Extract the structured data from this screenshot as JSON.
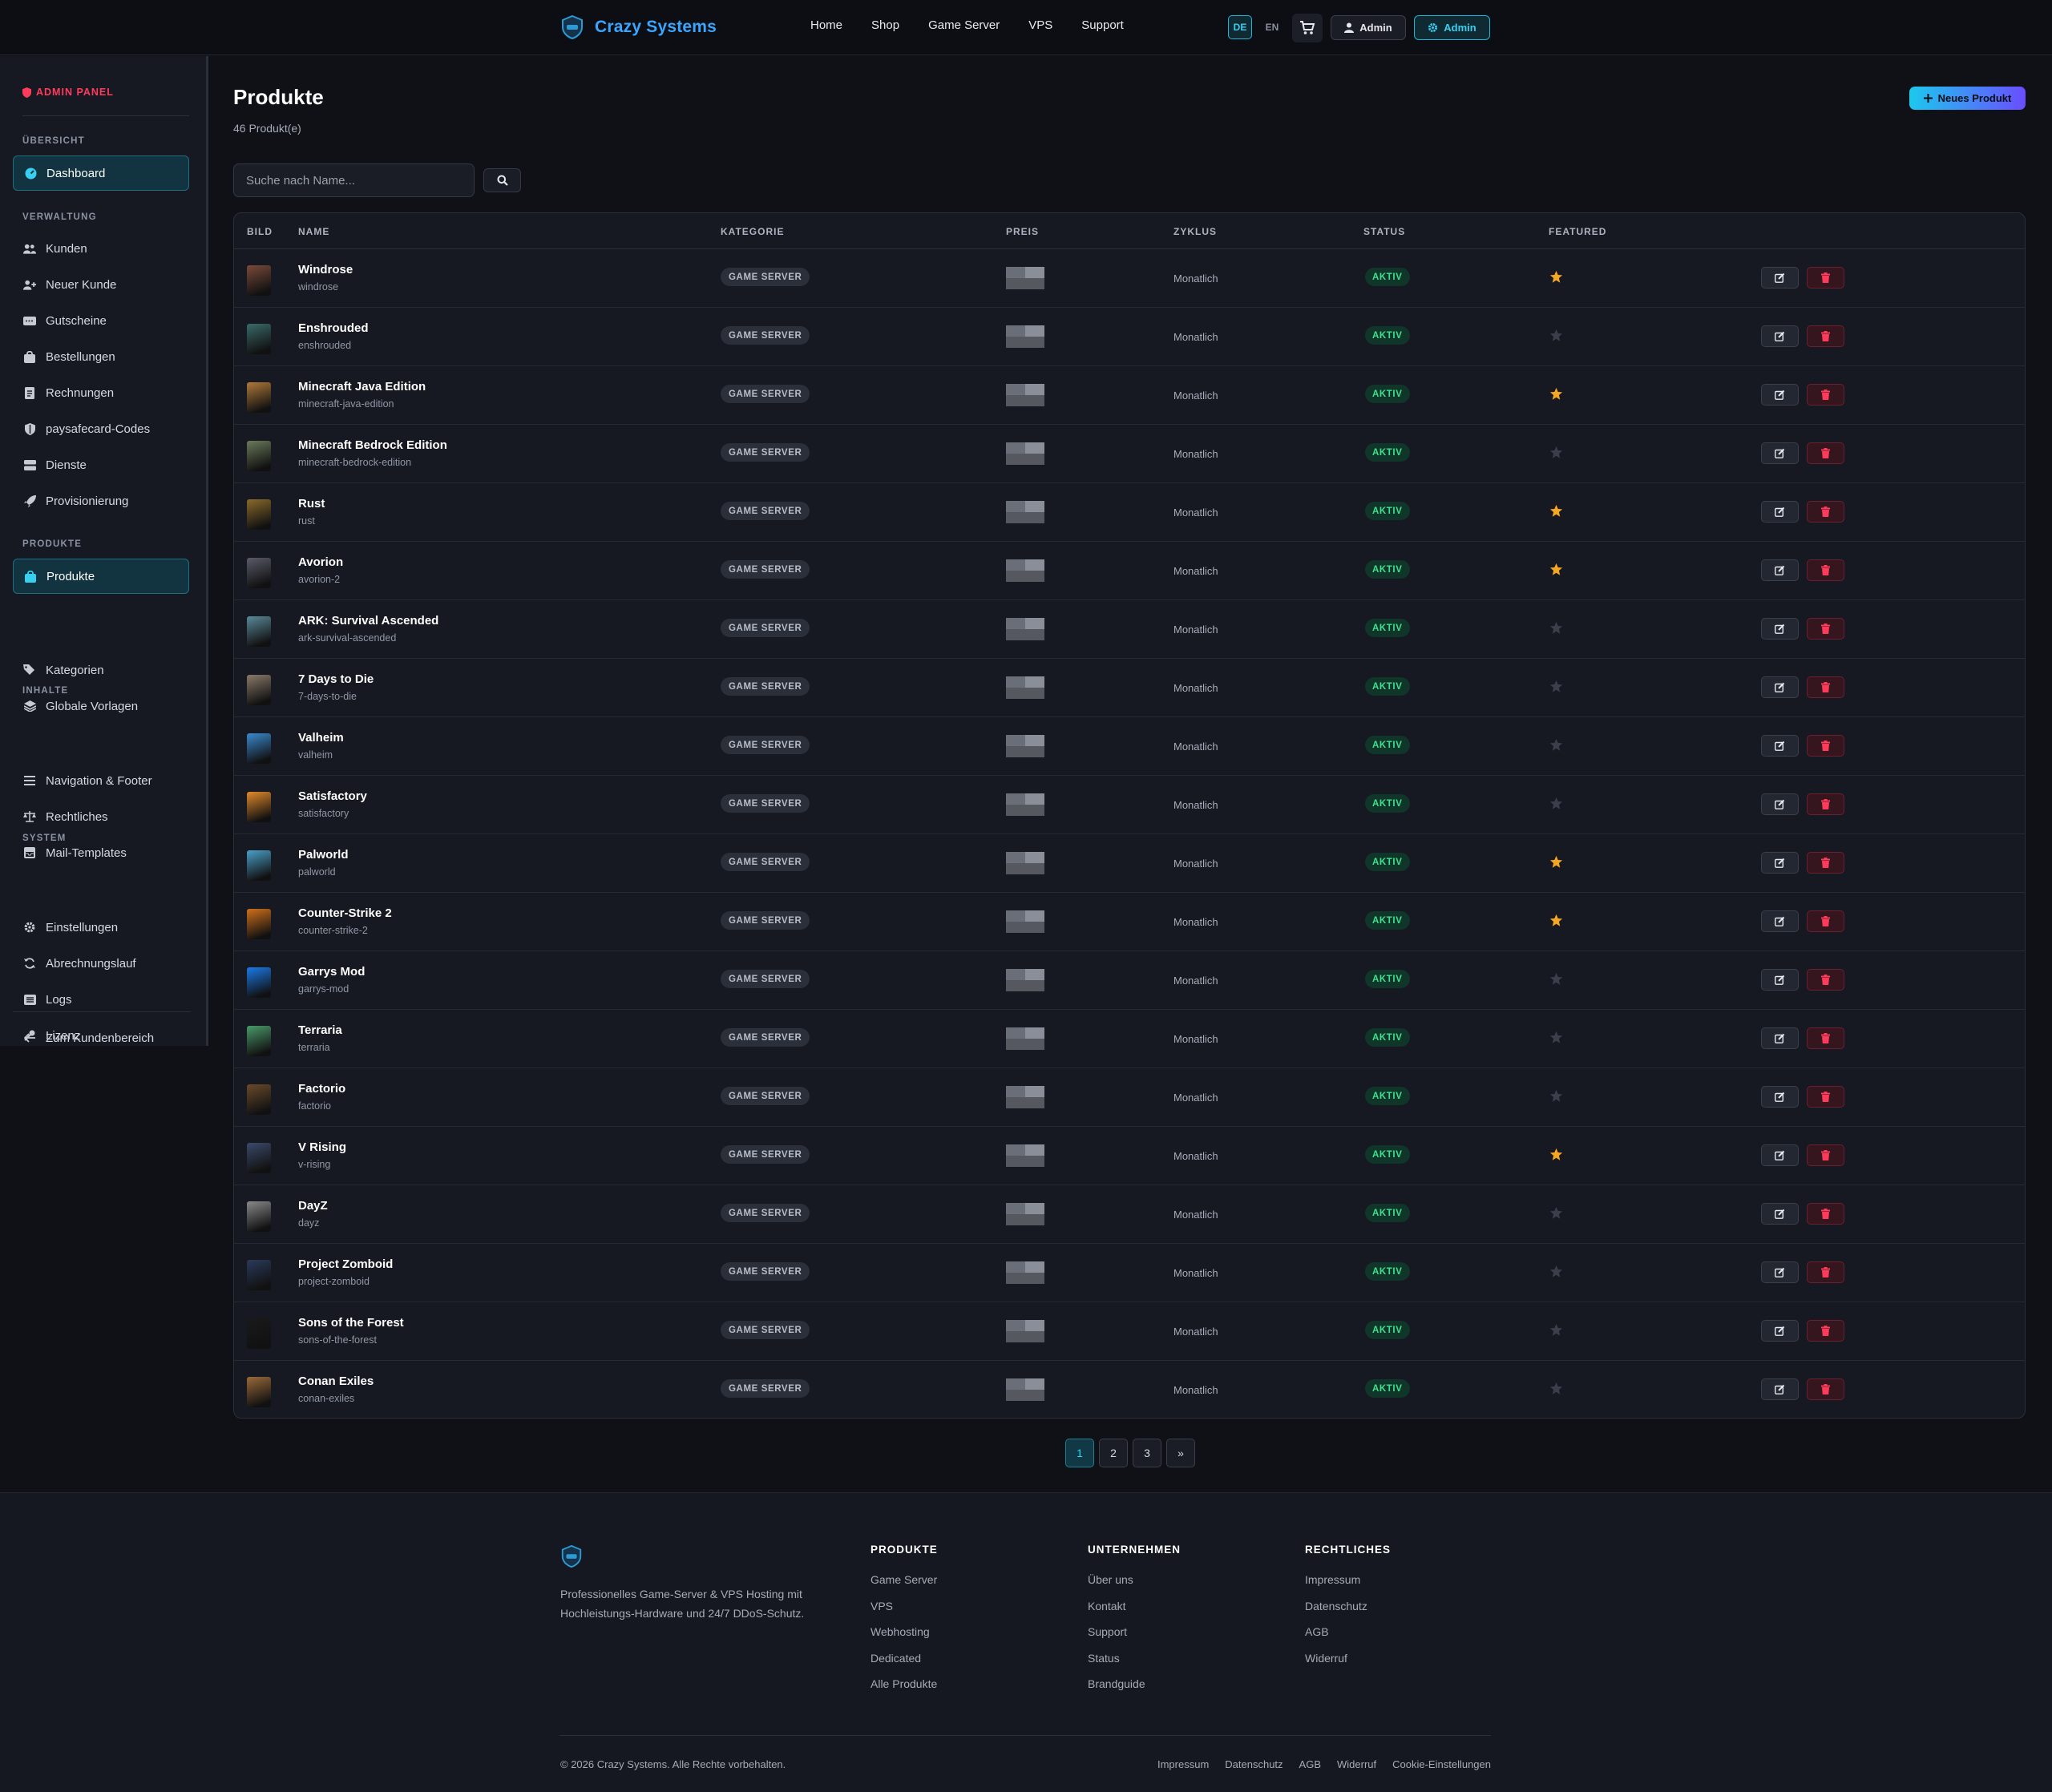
{
  "brand": {
    "name": "Crazy Systems"
  },
  "nav": {
    "items": [
      "Home",
      "Shop",
      "Game Server",
      "VPS",
      "Support"
    ]
  },
  "header": {
    "lang_de": "DE",
    "lang_en": "EN",
    "user_label": "Admin",
    "admin_label": "Admin"
  },
  "sidebar": {
    "title": "ADMIN PANEL",
    "sections": {
      "overview": "ÜBERSICHT",
      "management": "VERWALTUNG",
      "products": "PRODUKTE",
      "content": "INHALTE",
      "system": "SYSTEM"
    },
    "items": {
      "dashboard": "Dashboard",
      "customers": "Kunden",
      "new_customer": "Neuer Kunde",
      "vouchers": "Gutscheine",
      "orders": "Bestellungen",
      "invoices": "Rechnungen",
      "paysafecard": "paysafecard-Codes",
      "services": "Dienste",
      "provisioning": "Provisionierung",
      "products": "Produkte",
      "categories": "Kategorien",
      "templates": "Globale Vorlagen",
      "navigation": "Navigation & Footer",
      "legal": "Rechtliches",
      "mail": "Mail-Templates",
      "settings": "Einstellungen",
      "billing": "Abrechnungslauf",
      "logs": "Logs",
      "license": "Lizenz",
      "back": "Zum Kundenbereich"
    }
  },
  "main": {
    "title": "Produkte",
    "count": "46 Produkt(e)",
    "new_button": "Neues Produkt",
    "search_placeholder": "Suche nach Name..."
  },
  "table": {
    "headers": {
      "image": "BILD",
      "name": "NAME",
      "category": "KATEGORIE",
      "price": "PREIS",
      "cycle": "ZYKLUS",
      "status": "STATUS",
      "featured": "FEATURED"
    },
    "rows": [
      {
        "name": "Windrose",
        "slug": "windrose",
        "category": "GAME SERVER",
        "cycle": "Monatlich",
        "status": "AKTIV",
        "featured": true,
        "thumb": "#7a4a3a"
      },
      {
        "name": "Enshrouded",
        "slug": "enshrouded",
        "category": "GAME SERVER",
        "cycle": "Monatlich",
        "status": "AKTIV",
        "featured": false,
        "thumb": "#3a6a6a"
      },
      {
        "name": "Minecraft Java Edition",
        "slug": "minecraft-java-edition",
        "category": "GAME SERVER",
        "cycle": "Monatlich",
        "status": "AKTIV",
        "featured": true,
        "thumb": "#b07a3a"
      },
      {
        "name": "Minecraft Bedrock Edition",
        "slug": "minecraft-bedrock-edition",
        "category": "GAME SERVER",
        "cycle": "Monatlich",
        "status": "AKTIV",
        "featured": false,
        "thumb": "#6a7a5a"
      },
      {
        "name": "Rust",
        "slug": "rust",
        "category": "GAME SERVER",
        "cycle": "Monatlich",
        "status": "AKTIV",
        "featured": true,
        "thumb": "#8a6a2a"
      },
      {
        "name": "Avorion",
        "slug": "avorion-2",
        "category": "GAME SERVER",
        "cycle": "Monatlich",
        "status": "AKTIV",
        "featured": true,
        "thumb": "#5a5a6a"
      },
      {
        "name": "ARK: Survival Ascended",
        "slug": "ark-survival-ascended",
        "category": "GAME SERVER",
        "cycle": "Monatlich",
        "status": "AKTIV",
        "featured": false,
        "thumb": "#5a8a9a"
      },
      {
        "name": "7 Days to Die",
        "slug": "7-days-to-die",
        "category": "GAME SERVER",
        "cycle": "Monatlich",
        "status": "AKTIV",
        "featured": false,
        "thumb": "#8a7a6a"
      },
      {
        "name": "Valheim",
        "slug": "valheim",
        "category": "GAME SERVER",
        "cycle": "Monatlich",
        "status": "AKTIV",
        "featured": false,
        "thumb": "#3a8acf"
      },
      {
        "name": "Satisfactory",
        "slug": "satisfactory",
        "category": "GAME SERVER",
        "cycle": "Monatlich",
        "status": "AKTIV",
        "featured": false,
        "thumb": "#e08a2a"
      },
      {
        "name": "Palworld",
        "slug": "palworld",
        "category": "GAME SERVER",
        "cycle": "Monatlich",
        "status": "AKTIV",
        "featured": true,
        "thumb": "#4aa0c8"
      },
      {
        "name": "Counter-Strike 2",
        "slug": "counter-strike-2",
        "category": "GAME SERVER",
        "cycle": "Monatlich",
        "status": "AKTIV",
        "featured": true,
        "thumb": "#d0701a"
      },
      {
        "name": "Garrys Mod",
        "slug": "garrys-mod",
        "category": "GAME SERVER",
        "cycle": "Monatlich",
        "status": "AKTIV",
        "featured": false,
        "thumb": "#1a7ae8"
      },
      {
        "name": "Terraria",
        "slug": "terraria",
        "category": "GAME SERVER",
        "cycle": "Monatlich",
        "status": "AKTIV",
        "featured": false,
        "thumb": "#4a9a6a"
      },
      {
        "name": "Factorio",
        "slug": "factorio",
        "category": "GAME SERVER",
        "cycle": "Monatlich",
        "status": "AKTIV",
        "featured": false,
        "thumb": "#6a4a2a"
      },
      {
        "name": "V Rising",
        "slug": "v-rising",
        "category": "GAME SERVER",
        "cycle": "Monatlich",
        "status": "AKTIV",
        "featured": true,
        "thumb": "#3a4a6a"
      },
      {
        "name": "DayZ",
        "slug": "dayz",
        "category": "GAME SERVER",
        "cycle": "Monatlich",
        "status": "AKTIV",
        "featured": false,
        "thumb": "#8a8a8a"
      },
      {
        "name": "Project Zomboid",
        "slug": "project-zomboid",
        "category": "GAME SERVER",
        "cycle": "Monatlich",
        "status": "AKTIV",
        "featured": false,
        "thumb": "#2a3a5a"
      },
      {
        "name": "Sons of the Forest",
        "slug": "sons-of-the-forest",
        "category": "GAME SERVER",
        "cycle": "Monatlich",
        "status": "AKTIV",
        "featured": false,
        "thumb": "#1a1a1a"
      },
      {
        "name": "Conan Exiles",
        "slug": "conan-exiles",
        "category": "GAME SERVER",
        "cycle": "Monatlich",
        "status": "AKTIV",
        "featured": false,
        "thumb": "#9a6a3a"
      }
    ]
  },
  "pagination": {
    "pages": [
      "1",
      "2",
      "3"
    ],
    "next": "»",
    "current": "1"
  },
  "footer": {
    "description": "Professionelles Game-Server & VPS Hosting mit Hochleistungs-Hardware und 24/7 DDoS-Schutz.",
    "columns": [
      {
        "title": "PRODUKTE",
        "links": [
          "Game Server",
          "VPS",
          "Webhosting",
          "Dedicated",
          "Alle Produkte"
        ]
      },
      {
        "title": "UNTERNEHMEN",
        "links": [
          "Über uns",
          "Kontakt",
          "Support",
          "Status",
          "Brandguide"
        ]
      },
      {
        "title": "RECHTLICHES",
        "links": [
          "Impressum",
          "Datenschutz",
          "AGB",
          "Widerruf"
        ]
      }
    ],
    "copyright": "© 2026 Crazy Systems. Alle Rechte vorbehalten.",
    "legal_links": [
      "Impressum",
      "Datenschutz",
      "AGB",
      "Widerruf",
      "Cookie-Einstellungen"
    ]
  },
  "colors": {
    "accent": "#1cc8ee",
    "danger": "#ff3b5c",
    "success": "#3fe08f",
    "star": "#f5a623"
  }
}
